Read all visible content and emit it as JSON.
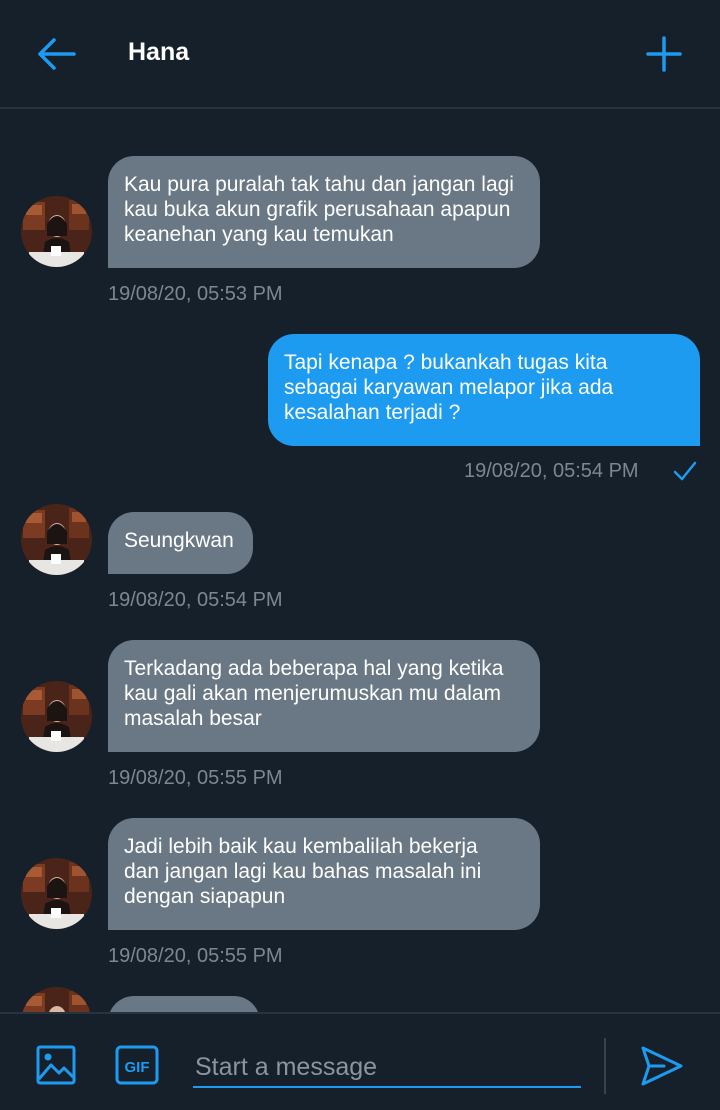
{
  "header": {
    "title": "Hana",
    "back_icon": "arrow-left-icon",
    "action_icon": "plus-icon",
    "accent": "#1d9bf0"
  },
  "messages": [
    {
      "direction": "incoming",
      "text": "Kau pura puralah tak tahu dan jangan lagi\nkau buka akun grafik perusahaan apapun\nkeanehan yang kau temukan",
      "time": "19/08/20, 05:53 PM"
    },
    {
      "direction": "outgoing",
      "text": "Tapi kenapa ? bukankah tugas kita\nsebagai karyawan melapor jika ada\nkesalahan terjadi ?",
      "time": "19/08/20, 05:54 PM",
      "status_icon": "checkmark-icon"
    },
    {
      "direction": "incoming",
      "text": "Seungkwan",
      "time": "19/08/20, 05:54 PM"
    },
    {
      "direction": "incoming",
      "text": "Terkadang ada beberapa hal yang ketika\nkau gali akan menjerumuskan mu dalam\nmasalah besar",
      "time": "19/08/20, 05:55 PM"
    },
    {
      "direction": "incoming",
      "text": "Jadi lebih baik kau kembalilah bekerja\ndan jangan lagi kau bahas masalah ini\ndengan siapapun",
      "time": "19/08/20, 05:55 PM"
    },
    {
      "direction": "incoming",
      "text": "",
      "time": ""
    }
  ],
  "composer": {
    "placeholder": "Start a message",
    "gif_label": "GIF",
    "image_icon": "image-icon",
    "send_icon": "send-icon"
  },
  "colors": {
    "background": "#15202b",
    "incoming_bubble": "#6a7886",
    "outgoing_bubble": "#1d9bf0",
    "timestamp": "#7b8791"
  }
}
